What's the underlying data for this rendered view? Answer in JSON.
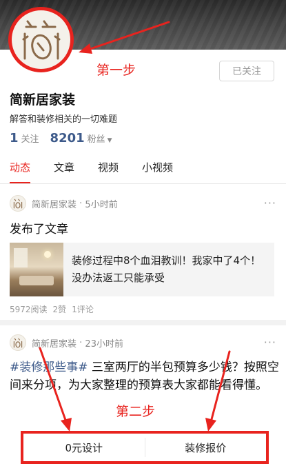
{
  "profile": {
    "name": "简新居家装",
    "bio": "解答和装修相关的一切难题",
    "following_count": "1",
    "following_label": "关注",
    "fans_count": "8201",
    "fans_label": "粉丝",
    "follow_button": "已关注"
  },
  "annotations": {
    "step1": "第一步",
    "step2": "第二步",
    "color": "#e8231e"
  },
  "tabs": [
    {
      "label": "动态",
      "active": true
    },
    {
      "label": "文章",
      "active": false
    },
    {
      "label": "视频",
      "active": false
    },
    {
      "label": "小视频",
      "active": false
    }
  ],
  "feed": {
    "post1": {
      "author": "简新居家装",
      "time": "5小时前",
      "action": "发布了文章",
      "article_title": "装修过程中8个血泪教训！我家中了4个！没办法返工只能承受",
      "reads": "5972阅读",
      "likes": "2赞",
      "comments": "1评论"
    },
    "post2": {
      "author": "简新居家装",
      "time": "23小时前",
      "hashtag": "#装修那些事#",
      "text": " 三室两厅的半包预算多少钱？按照空间来分项，为大家整理的预算表大家都能看得懂。"
    },
    "more_icon": "more-dots-icon"
  },
  "bottom_bar": {
    "left_label": "0元设计",
    "right_label": "装修报价"
  },
  "colors": {
    "accent": "#e8231e",
    "link": "#3d5a8a"
  }
}
